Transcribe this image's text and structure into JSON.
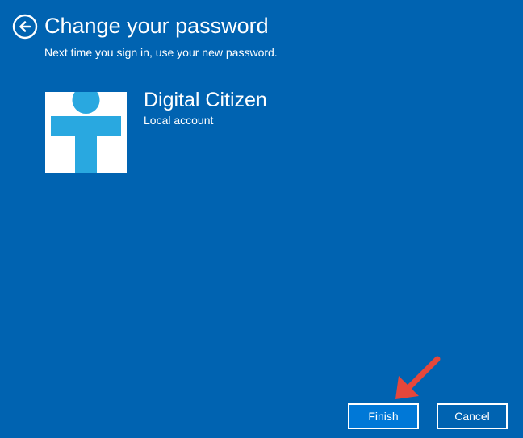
{
  "page": {
    "title": "Change your password",
    "subtitle": "Next time you sign in, use your new password."
  },
  "account": {
    "name": "Digital Citizen",
    "type": "Local account"
  },
  "buttons": {
    "finish_label": "Finish",
    "cancel_label": "Cancel"
  },
  "icons": {
    "back": "back-arrow-circle-icon",
    "avatar": "user-avatar-logo",
    "annotation": "red-pointer-arrow"
  },
  "colors": {
    "background": "#0063b1",
    "finish_button": "#0078d7",
    "avatar_logo": "#29a8e0",
    "annotation_arrow": "#e5473b",
    "text": "#ffffff"
  }
}
